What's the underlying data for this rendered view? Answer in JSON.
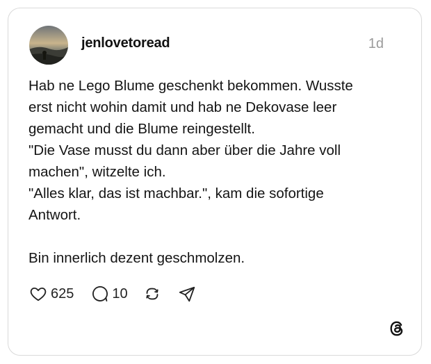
{
  "post": {
    "username": "jenlovetoread",
    "timestamp": "1d",
    "text": "Hab ne Lego Blume geschenkt bekommen. Wusste\nerst nicht wohin damit und hab ne Dekovase leer\ngemacht und die Blume reingestellt.\n\"Die Vase musst du dann aber über die Jahre voll\nmachen\", witzelte ich.\n\"Alles klar, das ist machbar.\", kam die sofortige\nAntwort.\n\nBin innerlich dezent geschmolzen."
  },
  "actions": {
    "likes": "625",
    "replies": "10"
  },
  "icons": {
    "like": "heart-icon",
    "reply": "speech-bubble-icon",
    "repost": "repost-icon",
    "share": "send-icon",
    "brand": "threads-logo-icon"
  },
  "colors": {
    "text": "#141414",
    "muted": "#9a9a9a",
    "border": "#d9d9d9"
  }
}
